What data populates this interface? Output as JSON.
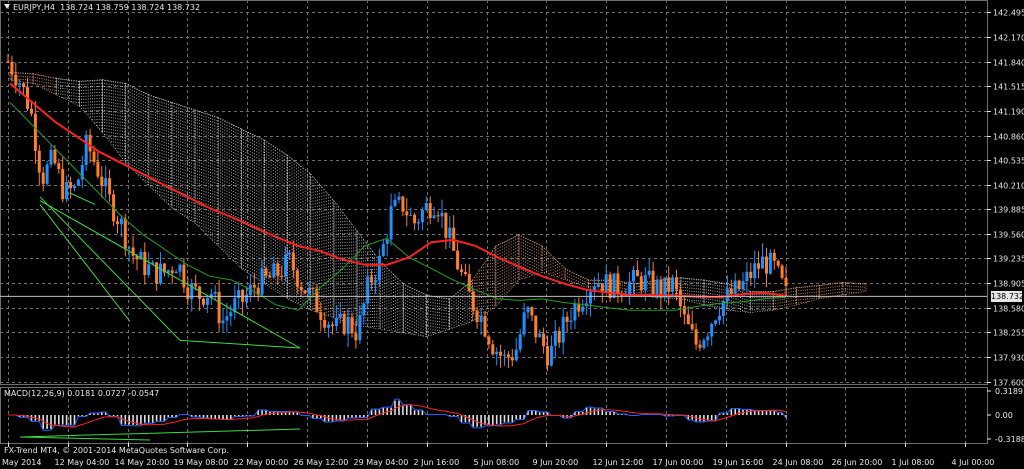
{
  "header": {
    "symbol_tf": "EURJPY,H4",
    "ohlc": "138.724 138.759 138.724 138.732"
  },
  "current_price_tag": "138.732",
  "macd_label": "MACD(12,26,9) 0.0181 0.0727 -0.0547",
  "copyright": "FX-Trend MT4, © 2001-2014 MetaQuotes Software Corp.",
  "colors": {
    "background": "#000000",
    "grid": "#6e6e6e",
    "bull_candle": "#1e90ff",
    "bear_candle": "#ff7f27",
    "ma_red": "#ff2020",
    "ma_green": "#1e9e1e",
    "cloud_bear": "#ffb37d",
    "cloud_bull": "#e0e0e0",
    "macd_hist": "#e0e0e0",
    "macd_main": "#2060ff",
    "macd_signal": "#ff2020",
    "divergence": "#3cdc3c"
  },
  "chart_data": [
    {
      "type": "candlestick",
      "instrument": "EURJPY",
      "timeframe": "H4",
      "price_ticks": [
        "142.495",
        "142.170",
        "141.840",
        "141.515",
        "141.190",
        "140.860",
        "140.535",
        "140.210",
        "139.885",
        "139.560",
        "139.235",
        "138.905",
        "138.580",
        "138.255",
        "137.930",
        "137.600"
      ],
      "time_labels": [
        "May 2014",
        "12 May 04:00",
        "14 May 20:00",
        "19 May 08:00",
        "22 May 00:00",
        "26 May 12:00",
        "29 May 04:00",
        "2 Jun 16:00",
        "5 Jun 08:00",
        "9 Jun 20:00",
        "12 Jun 12:00",
        "17 Jun 00:00",
        "19 Jun 16:00",
        "24 Jun 08:00",
        "26 Jun 20:00",
        "1 Jul 08:00",
        "4 Jul 00:00"
      ],
      "ylim": [
        137.6,
        142.495
      ],
      "current_price": 138.732,
      "close_path": [
        141.84,
        141.6,
        141.2,
        140.3,
        140.55,
        140.1,
        140.15,
        140.75,
        140.4,
        140.0,
        139.7,
        139.3,
        139.15,
        139.05,
        139.05,
        139.2,
        138.85,
        138.75,
        138.8,
        138.4,
        138.6,
        138.7,
        138.9,
        138.95,
        139.05,
        139.2,
        138.9,
        138.7,
        138.5,
        138.3,
        138.4,
        138.25,
        138.9,
        139.2,
        139.85,
        139.95,
        139.7,
        139.9,
        140.0,
        139.55,
        139.1,
        138.7,
        138.45,
        138.1,
        137.9,
        138.0,
        138.55,
        138.2,
        137.95,
        138.25,
        138.55,
        138.75,
        138.95,
        138.9,
        138.85,
        138.9,
        138.95,
        138.9,
        138.8,
        138.9,
        138.4,
        138.1,
        138.3,
        138.6,
        138.75,
        138.85,
        139.05,
        139.2,
        139.1,
        138.75
      ],
      "ma_red": [
        141.55,
        141.3,
        141.05,
        140.85,
        140.65,
        140.5,
        140.35,
        140.2,
        140.05,
        139.9,
        139.78,
        139.65,
        139.52,
        139.4,
        139.33,
        139.22,
        139.15,
        139.15,
        139.25,
        139.45,
        139.48,
        139.4,
        139.25,
        139.12,
        139.0,
        138.9,
        138.82,
        138.78,
        138.75,
        138.75,
        138.74,
        138.73,
        138.72,
        138.76,
        138.78,
        138.74
      ],
      "ma_green": [
        141.3,
        141.0,
        140.7,
        140.4,
        140.1,
        139.8,
        139.55,
        139.35,
        139.15,
        139.0,
        138.95,
        138.8,
        138.62,
        138.55,
        138.85,
        139.1,
        139.4,
        139.5,
        139.25,
        139.1,
        138.95,
        138.82,
        138.7,
        138.68,
        138.7,
        138.65,
        138.62,
        138.58,
        138.55,
        138.55,
        138.55,
        138.6,
        138.64,
        138.66,
        138.7,
        138.72
      ],
      "ichimoku_cloud": {
        "top": [
          141.7,
          141.68,
          141.62,
          141.58,
          141.6,
          141.55,
          141.4,
          141.3,
          141.2,
          141.1,
          140.95,
          140.8,
          140.6,
          140.35,
          140.0,
          139.6,
          139.2,
          138.9,
          138.75,
          138.7,
          138.95,
          139.4,
          139.55,
          139.4,
          139.1,
          138.95,
          138.95,
          138.9,
          138.95,
          138.98,
          138.95,
          138.9,
          138.8,
          138.8,
          138.85,
          138.88,
          138.92,
          138.9
        ],
        "bottom": [
          141.6,
          141.55,
          141.4,
          141.25,
          140.9,
          140.5,
          140.2,
          139.9,
          139.7,
          139.4,
          139.1,
          138.9,
          138.7,
          138.55,
          138.45,
          138.35,
          138.3,
          138.25,
          138.2,
          138.3,
          138.4,
          138.6,
          138.95,
          139.05,
          138.95,
          138.85,
          138.8,
          138.75,
          138.72,
          138.7,
          138.62,
          138.55,
          138.52,
          138.55,
          138.62,
          138.7,
          138.75,
          138.8
        ]
      },
      "divergence_lines": [
        {
          "from": [
            140.05,
            139.95
          ],
          "to": [
            138.15,
            138.05
          ]
        }
      ]
    },
    {
      "type": "macd",
      "title": "MACD(12,26,9)",
      "main": 0.0181,
      "signal": 0.0727,
      "histogram": -0.0547,
      "ticks": [
        "0.3189",
        "0.00",
        "-0.3188"
      ],
      "ylim": [
        -0.3188,
        0.3189
      ]
    }
  ]
}
